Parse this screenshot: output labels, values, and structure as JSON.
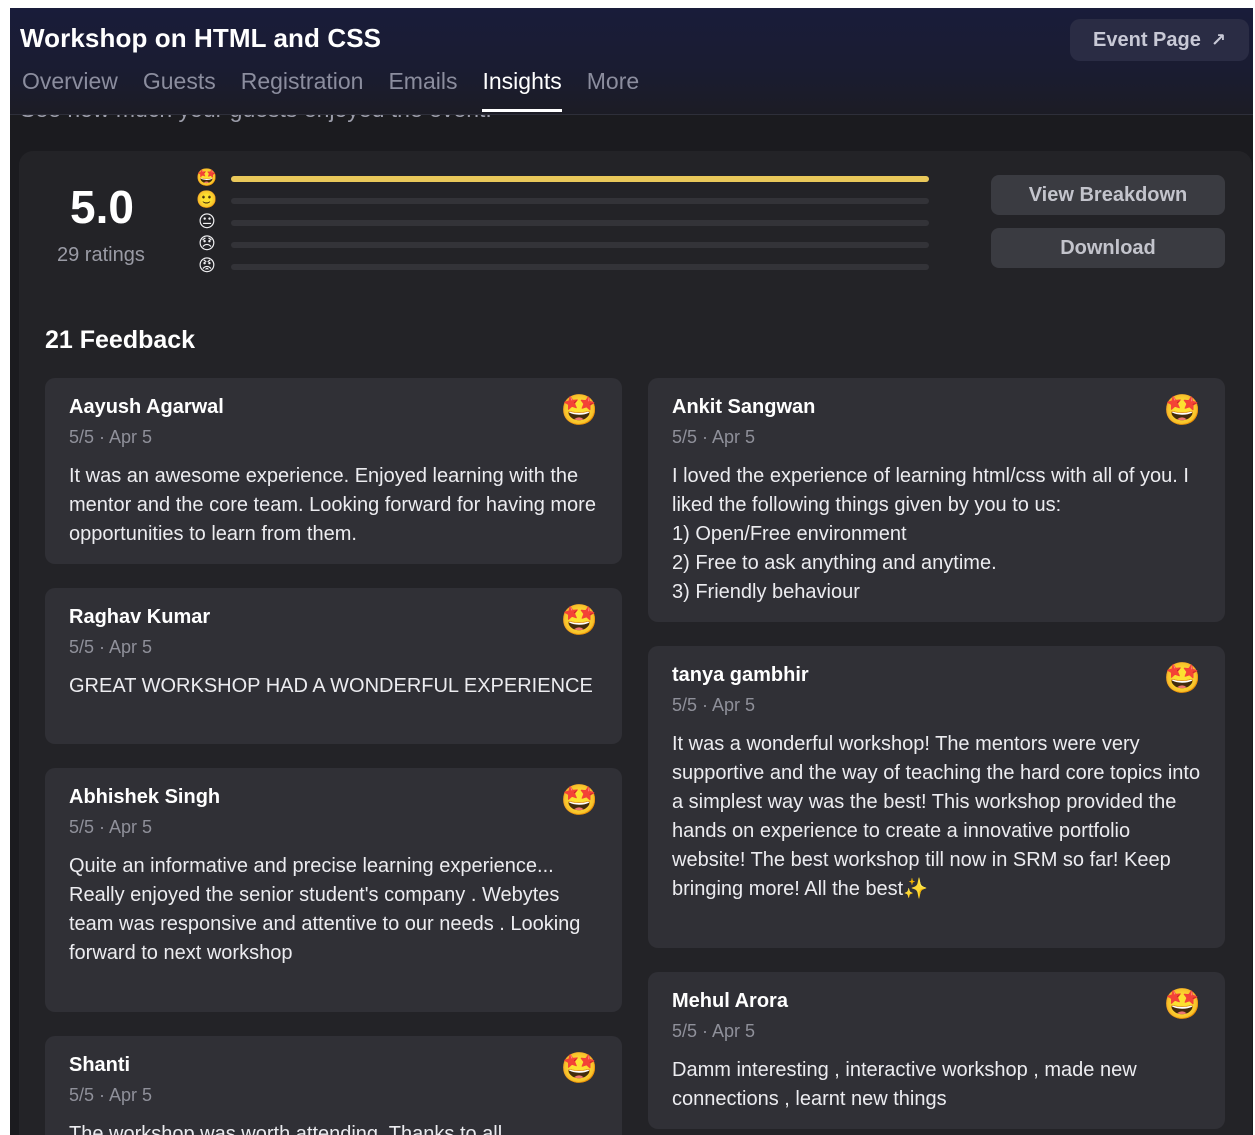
{
  "header": {
    "title": "Workshop on HTML and CSS",
    "event_page_label": "Event Page",
    "event_page_icon": "external-arrow-icon",
    "tabs": [
      "Overview",
      "Guests",
      "Registration",
      "Emails",
      "Insights",
      "More"
    ],
    "active_tab": "Insights",
    "subtitle": "See how much your guests enjoyed the event."
  },
  "summary": {
    "score": "5.0",
    "ratings_label": "29 ratings",
    "distribution": [
      {
        "emoji": "🤩",
        "fraction": 1.0
      },
      {
        "emoji": "🙂",
        "fraction": 0.0
      },
      {
        "emoji": "😐",
        "fraction": 0.0
      },
      {
        "emoji": "😞",
        "fraction": 0.0
      },
      {
        "emoji": "😡",
        "fraction": 0.0
      }
    ],
    "view_breakdown_label": "View Breakdown",
    "download_label": "Download",
    "bar_color": "#e9c85a"
  },
  "feedback": {
    "title": "21 Feedback",
    "items": [
      {
        "name": "Aayush Agarwal",
        "meta": "5/5 · Apr 5",
        "emoji": "🤩",
        "text": "It was an awesome experience. Enjoyed learning with the mentor and the core team. Looking forward for having more opportunities to learn from them."
      },
      {
        "name": "Ankit Sangwan",
        "meta": "5/5 · Apr 5",
        "emoji": "🤩",
        "text": "I loved the experience of learning html/css with all of you. I liked the following things given by you to us:\n1) Open/Free environment\n2) Free to ask anything and anytime.\n3) Friendly behaviour"
      },
      {
        "name": "Raghav Kumar",
        "meta": "5/5 · Apr 5",
        "emoji": "🤩",
        "text": "GREAT WORKSHOP HAD A WONDERFUL EXPERIENCE"
      },
      {
        "name": "tanya gambhir",
        "meta": "5/5 · Apr 5",
        "emoji": "🤩",
        "text": "It was a wonderful workshop! The mentors were very supportive and the way of teaching the hard core topics into a simplest way was the best! This workshop provided the hands on experience to create a innovative portfolio website! The best workshop till now in SRM so far! Keep bringing more! All the best✨"
      },
      {
        "name": "Abhishek Singh",
        "meta": "5/5 · Apr 5",
        "emoji": "🤩",
        "text": "Quite an informative and precise learning experience... Really enjoyed the senior student's company . Webytes team was responsive and attentive to our needs . Looking forward to next workshop"
      },
      {
        "name": "Mehul Arora",
        "meta": "5/5 · Apr 5",
        "emoji": "🤩",
        "text": "Damm interesting , interactive workshop , made new connections , learnt new things"
      },
      {
        "name": "Shanti",
        "meta": "5/5 · Apr 5",
        "emoji": "🤩",
        "text": "The workshop was worth attending. Thanks to all"
      }
    ]
  }
}
